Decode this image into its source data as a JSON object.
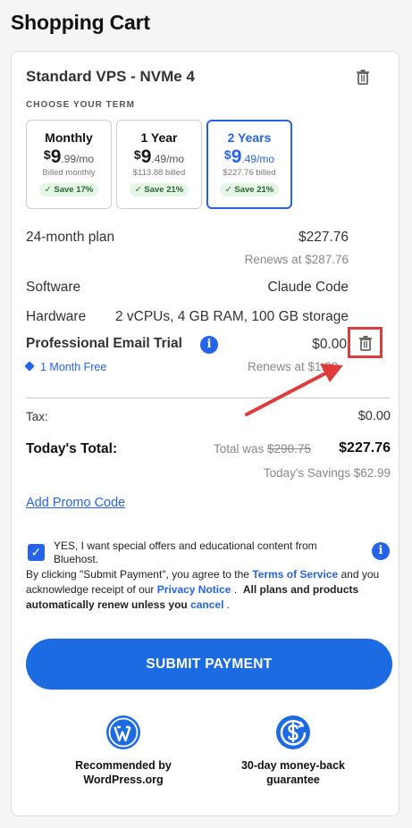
{
  "page_title": "Shopping Cart",
  "product": {
    "name": "Standard VPS - NVMe 4"
  },
  "term_section": {
    "label": "CHOOSE YOUR TERM",
    "options": [
      {
        "name": "Monthly",
        "dollar": "$",
        "price_whole": "9",
        "price_cents": ".99/mo",
        "billed": "Billed monthly",
        "save": "Save 17%"
      },
      {
        "name": "1 Year",
        "dollar": "$",
        "price_whole": "9",
        "price_cents": ".49/mo",
        "billed": "$113.88 billed",
        "save": "Save 21%"
      },
      {
        "name": "2 Years",
        "dollar": "$",
        "price_whole": "9",
        "price_cents": ".49/mo",
        "billed": "$227.76 billed",
        "save": "Save 21%"
      }
    ],
    "selected_index": 2
  },
  "plan": {
    "label": "24-month plan",
    "price": "$227.76",
    "renews": "Renews at $287.76"
  },
  "software": {
    "label": "Software",
    "value": "Claude Code"
  },
  "hardware": {
    "label": "Hardware",
    "value": "2 vCPUs, 4 GB RAM, 100 GB storage"
  },
  "email_trial": {
    "title": "Professional Email Trial",
    "price": "$0.00",
    "tag": "1 Month Free",
    "renews": "Renews at $1.99"
  },
  "tax": {
    "label": "Tax:",
    "value": "$0.00"
  },
  "total": {
    "label": "Today's Total:",
    "was_prefix": "Total was",
    "was_value": "$290.75",
    "value": "$227.76",
    "savings": "Today's Savings $62.99"
  },
  "promo_link": "Add Promo Code",
  "consent": {
    "checked": true,
    "text": "YES, I want special offers and educational content from Bluehost."
  },
  "legal": {
    "part1": "By clicking \"Submit Payment\", you agree to the",
    "terms_link": "Terms of Service",
    "part2": "and you acknowledge receipt of our",
    "privacy_link": "Privacy Notice",
    "part3": ".",
    "bold": "All plans and products automatically renew unless you",
    "cancel_link": "cancel",
    "part4": "."
  },
  "submit_label": "SUBMIT PAYMENT",
  "badges": [
    {
      "icon": "wordpress-icon",
      "text": "Recommended by WordPress.org"
    },
    {
      "icon": "money-back-icon",
      "text": "30-day money-back guarantee"
    }
  ],
  "colors": {
    "accent": "#1d6be3",
    "save_bg": "#e5f5e7",
    "save_text": "#246b2d",
    "annotation": "#e03b3b"
  }
}
